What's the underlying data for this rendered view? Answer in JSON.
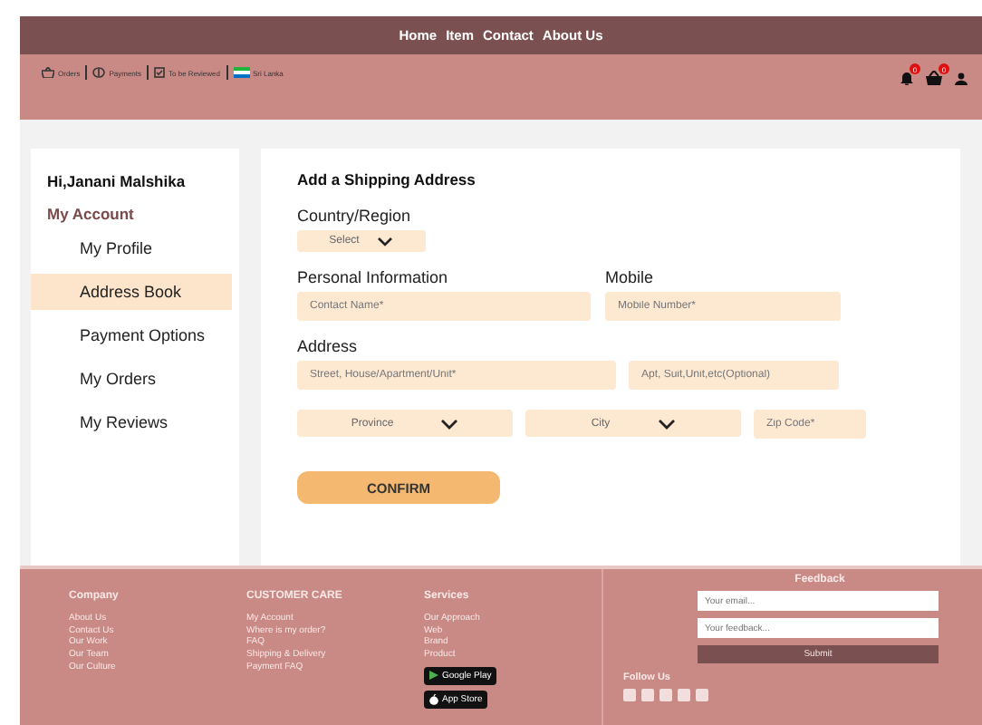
{
  "nav": [
    "Home",
    "Item",
    "Contact",
    "About Us"
  ],
  "toplinks": [
    {
      "kind": "orders",
      "label": "Orders"
    },
    {
      "kind": "payments",
      "label": "Payments"
    },
    {
      "kind": "review",
      "label": "To be Reviewed"
    },
    {
      "kind": "flag",
      "label": "Sri Lanka"
    }
  ],
  "badges": {
    "notifications": "0",
    "cart": "0"
  },
  "sidebar": {
    "greeting": "Hi,Janani Malshika",
    "heading": "My Account",
    "items": [
      {
        "label": "My Profile",
        "selected": false
      },
      {
        "label": "Address Book",
        "selected": true
      },
      {
        "label": "Payment Options",
        "selected": false
      },
      {
        "label": "My Orders",
        "selected": false
      },
      {
        "label": "My Reviews",
        "selected": false
      }
    ]
  },
  "form": {
    "title": "Add a Shipping Address",
    "country_label": "Country/Region",
    "country_select": "Select",
    "personal_label": "Personal Information",
    "mobile_label": "Mobile",
    "contact_placeholder": "Contact Name*",
    "mobile_placeholder": "Mobile Number*",
    "address_label": "Address",
    "street_placeholder": "Street, House/Apartment/Unit*",
    "apt_placeholder": "Apt, Suit,Unit,etc(Optional)",
    "province_select": "Province",
    "city_select": "City",
    "zip_placeholder": "Zip Code*",
    "confirm": "CONFIRM"
  },
  "footer": {
    "columns": [
      {
        "title": "Company",
        "links": [
          "About Us",
          "Contact Us",
          "Our Work",
          "Our Team",
          "Our Culture"
        ]
      },
      {
        "title": "CUSTOMER CARE",
        "links": [
          "My Account",
          "Where is my order?",
          "FAQ",
          "Shipping & Delivery",
          "Payment FAQ"
        ]
      },
      {
        "title": "Services",
        "links": [
          "Our Approach",
          "Web",
          "Brand",
          "Product"
        ]
      }
    ],
    "stores": [
      "Google Play",
      "App Store"
    ],
    "feedback_title": "Feedback",
    "email_placeholder": "Your email...",
    "feedback_placeholder": "Your feedback...",
    "submit": "Submit",
    "follow": "Follow Us"
  }
}
